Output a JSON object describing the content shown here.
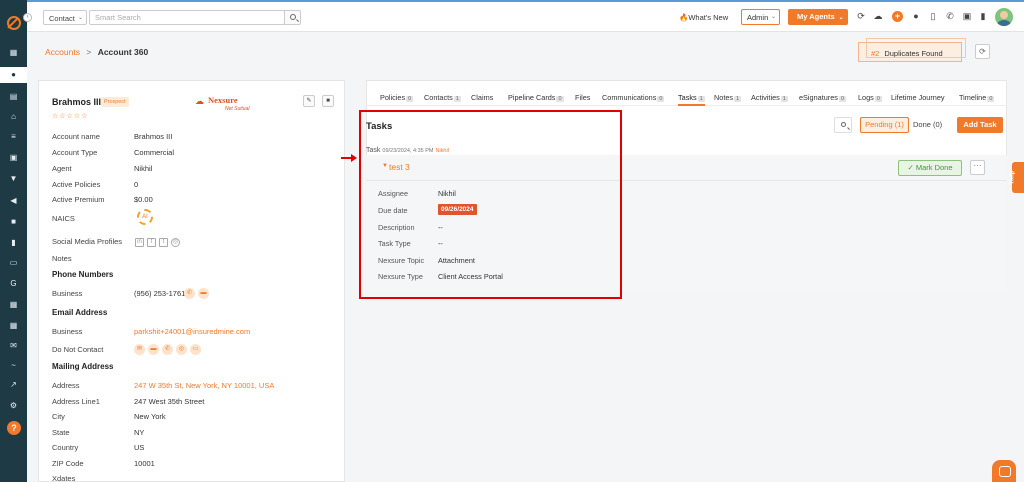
{
  "colors": {
    "accent": "#f07a2a",
    "sidebar": "#1d3a45",
    "alert": "#e00000",
    "success": "#4b8f3a"
  },
  "topbar": {
    "contact_select": "Contact",
    "search_placeholder": "Smart Search",
    "whats_new": "What's New",
    "admin_select": "Admin",
    "my_agents": "My Agents"
  },
  "breadcrumb": {
    "parent": "Accounts",
    "separator": ">",
    "current": "Account 360"
  },
  "duplicates": {
    "number": "#2",
    "label": "Duplicates Found"
  },
  "account": {
    "name": "Brahmos III",
    "status_badge": "Prospect",
    "stars": "☆☆☆☆☆",
    "carrier_logo": {
      "name": "Nexsure",
      "tagline": "Net Suitual"
    },
    "fields": [
      {
        "label": "Account name",
        "value": "Brahmos III"
      },
      {
        "label": "Account Type",
        "value": "Commercial"
      },
      {
        "label": "Agent",
        "value": "Nikhil"
      },
      {
        "label": "Active Policies",
        "value": "0"
      },
      {
        "label": "Active Premium",
        "value": "$0.00"
      }
    ],
    "naics_label": "NAICS",
    "social_label": "Social Media Profiles",
    "notes_label": "Notes",
    "phone_section": "Phone Numbers",
    "phone": {
      "label": "Business",
      "value": "(956) 253-1761"
    },
    "email_section": "Email Address",
    "email": {
      "label": "Business",
      "value": "parkshit+24001@insuredmine.com"
    },
    "dnc_label": "Do Not Contact",
    "mailing_section": "Mailing Address",
    "address_fields": [
      {
        "label": "Address",
        "value": "247 W 35th St, New York, NY 10001, USA"
      },
      {
        "label": "Address Line1",
        "value": "247 West 35th Street"
      },
      {
        "label": "City",
        "value": "New York"
      },
      {
        "label": "State",
        "value": "NY"
      },
      {
        "label": "Country",
        "value": "US"
      },
      {
        "label": "ZIP Code",
        "value": "10001"
      },
      {
        "label": "Xdates",
        "value": ""
      }
    ]
  },
  "tabs": [
    {
      "label": "Policies",
      "count": "0"
    },
    {
      "label": "Contacts",
      "count": "1"
    },
    {
      "label": "Claims",
      "count": ""
    },
    {
      "label": "Pipeline Cards",
      "count": "0"
    },
    {
      "label": "Files",
      "count": ""
    },
    {
      "label": "Communications",
      "count": "0"
    },
    {
      "label": "Tasks",
      "count": "1"
    },
    {
      "label": "Notes",
      "count": "1"
    },
    {
      "label": "Activities",
      "count": "1"
    },
    {
      "label": "eSignatures",
      "count": "0"
    },
    {
      "label": "Logs",
      "count": "0"
    },
    {
      "label": "Lifetime Journey",
      "count": ""
    },
    {
      "label": "Timeline",
      "count": "0"
    }
  ],
  "tasks": {
    "title": "Tasks",
    "pending": "Pending (1)",
    "done": "Done (0)",
    "add_task": "Add Task",
    "task_prefix": "Task",
    "task_date": "09/23/2024, 4:35 PM",
    "task_user": "Nikhil",
    "task_name": "test 3",
    "mark_done": "Mark Done",
    "more": "···",
    "details": [
      {
        "label": "Assignee",
        "value": "Nikhil"
      },
      {
        "label": "Due date",
        "value": "09/26/2024"
      },
      {
        "label": "Description",
        "value": "--"
      },
      {
        "label": "Task Type",
        "value": "--"
      },
      {
        "label": "Nexsure Topic",
        "value": "Attachment"
      },
      {
        "label": "Nexsure Type",
        "value": "Client Access Portal"
      }
    ]
  },
  "help_tab": "Help"
}
